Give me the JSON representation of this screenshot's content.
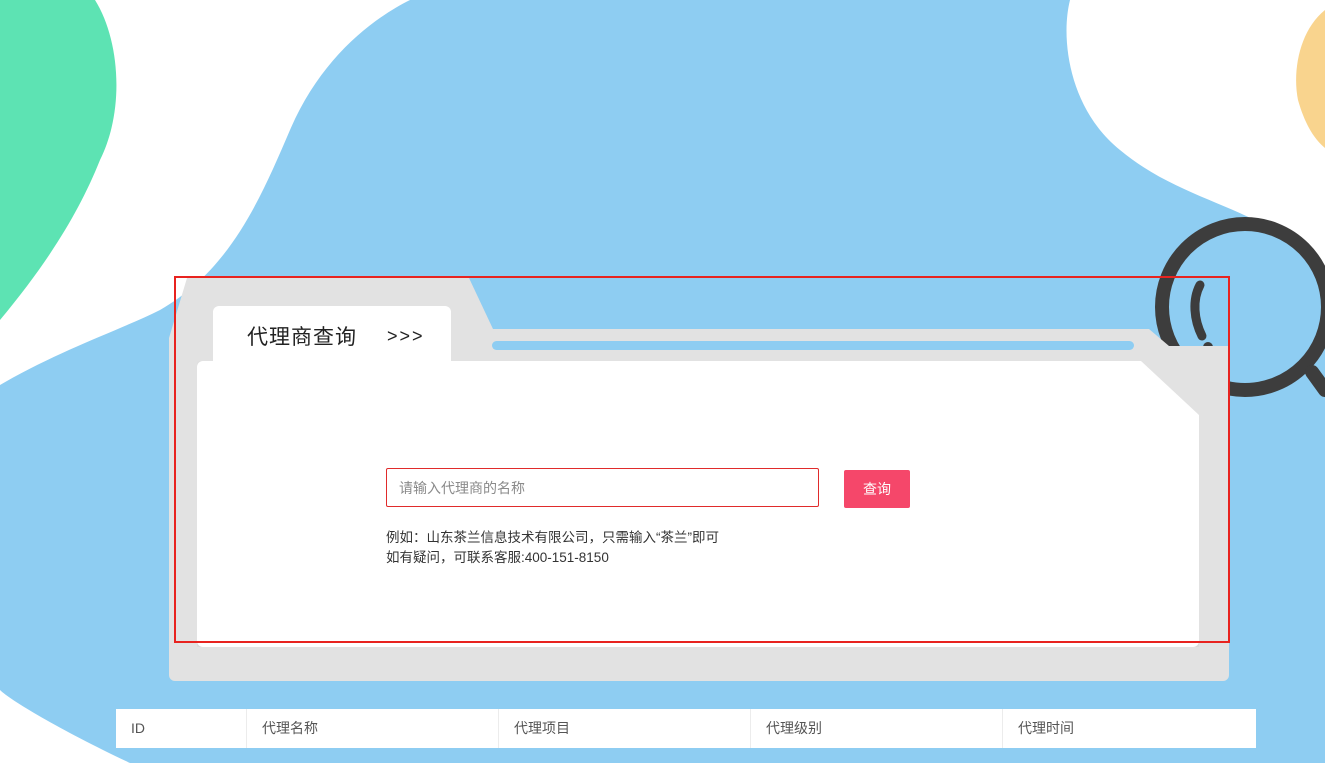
{
  "colors": {
    "background_blue": "#8ecdf2",
    "blob_green": "#5de3b3",
    "blob_orange": "#f9d48e",
    "magnifier": "#3d3d3d",
    "accent_button": "#f5476a",
    "input_border": "#e02b2b",
    "annotation_frame": "#e8231f"
  },
  "query_panel": {
    "tab_title": "代理商查询",
    "tab_arrows": ">>>",
    "search_placeholder": "请输入代理商的名称",
    "search_value": "",
    "search_button_label": "查询",
    "hint_line1": "例如：山东茶兰信息技术有限公司，只需输入“茶兰”即可",
    "hint_line2": "如有疑问，可联系客服:400-151-8150"
  },
  "table": {
    "headers": [
      "ID",
      "代理名称",
      "代理项目",
      "代理级别",
      "代理时间"
    ]
  },
  "decor": {
    "magnifier_icon": "magnifier-icon"
  }
}
